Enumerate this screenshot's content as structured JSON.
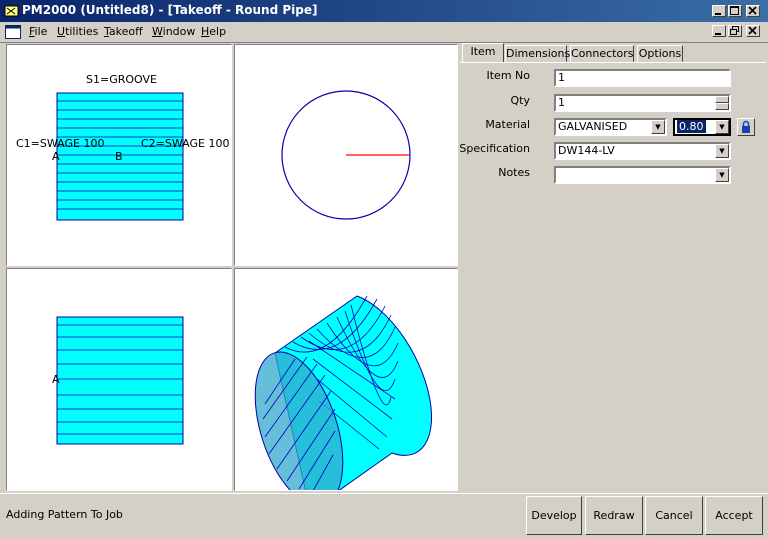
{
  "window": {
    "title": "PM2000 (Untitled8) - [Takeoff - Round Pipe]"
  },
  "menu": {
    "items": [
      {
        "hot": "F",
        "rest": "ile"
      },
      {
        "hot": "U",
        "rest": "tilities"
      },
      {
        "hot": "T",
        "rest": "akeoff"
      },
      {
        "hot": "W",
        "rest": "indow"
      },
      {
        "hot": "H",
        "rest": "elp"
      }
    ]
  },
  "views": {
    "top": {
      "s1": "S1=GROOVE",
      "c1": "C1=SWAGE 100",
      "c2": "C2=SWAGE 100",
      "a": "A",
      "b": "B"
    },
    "front": {
      "a": "A"
    }
  },
  "tabs": [
    "Item",
    "Dimensions",
    "Connectors",
    "Options"
  ],
  "form": {
    "item_no": {
      "label": "Item No",
      "value": "1"
    },
    "qty": {
      "label": "Qty",
      "value": "1"
    },
    "material": {
      "label": "Material",
      "value": "GALVANISED",
      "gauge": "0.80"
    },
    "specification": {
      "label": "Specification",
      "value": "DW144-LV"
    },
    "notes": {
      "label": "Notes",
      "value": ""
    }
  },
  "status": {
    "text": "Adding Pattern To Job"
  },
  "buttons": {
    "develop": "Develop",
    "redraw": "Redraw",
    "cancel": "Cancel",
    "accept": "Accept"
  },
  "colors": {
    "fill": "#00ffff",
    "stripe": "#0000c0",
    "outline": "#0000aa",
    "radius": "#ff0000",
    "titlebar": "#0a246a"
  }
}
